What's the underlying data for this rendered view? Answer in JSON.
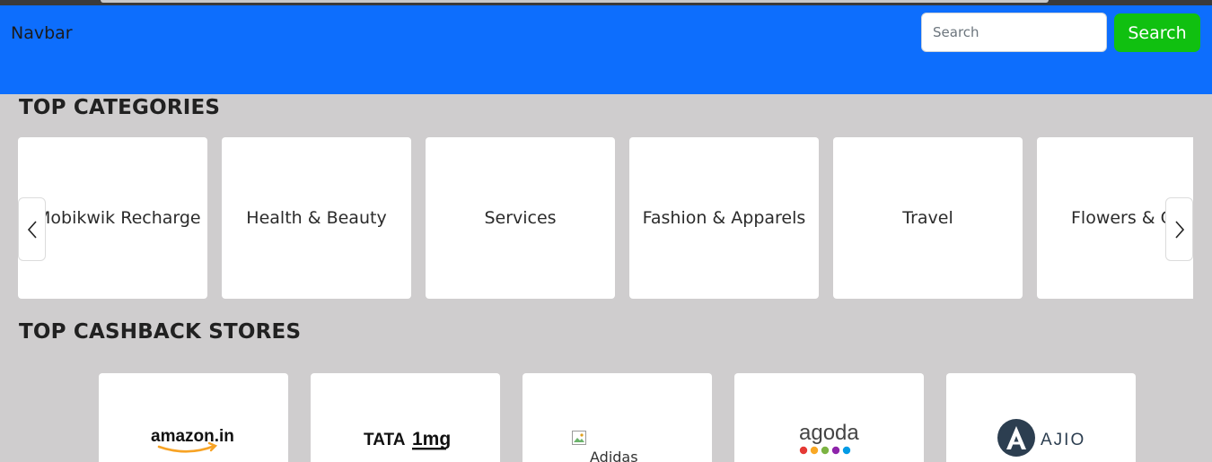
{
  "navbar": {
    "brand": "Navbar",
    "search_placeholder": "Search",
    "search_button": "Search"
  },
  "categories": {
    "title": "TOP CATEGORIES",
    "items": [
      "Mobikwik Recharge",
      "Health & Beauty",
      "Services",
      "Fashion & Apparels",
      "Travel",
      "Flowers & Gifts"
    ]
  },
  "stores": {
    "title": "TOP CASHBACK STORES",
    "items": [
      {
        "logo": "amazon.in"
      },
      {
        "logo_part1": "TATA",
        "logo_part2": "1mg"
      },
      {
        "alt": "Adidas"
      },
      {
        "logo": "agoda"
      },
      {
        "logo": "AJIO"
      }
    ]
  },
  "colors": {
    "navbar": "#0d6efd",
    "search_button": "#10c010",
    "page_bg": "#cfcdce",
    "amazon_orange": "#f7a325",
    "ajio_navy": "#2c3e50"
  },
  "icons": [
    "chevron-left-icon",
    "chevron-right-icon",
    "broken-image-icon"
  ]
}
